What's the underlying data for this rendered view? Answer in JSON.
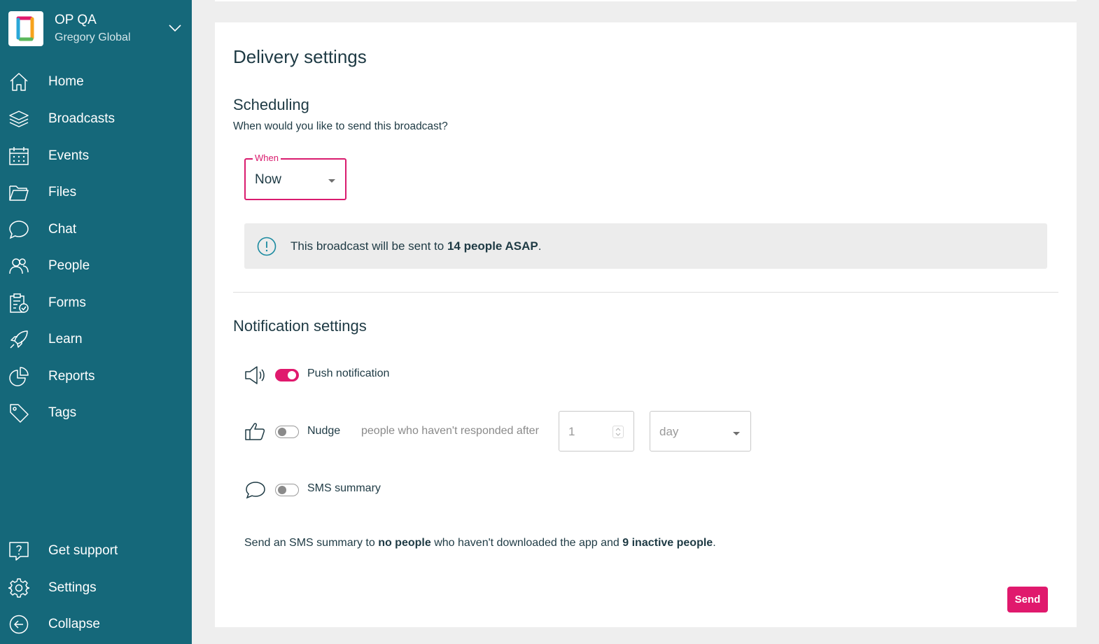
{
  "org": {
    "name": "OP QA",
    "subtitle": "Gregory Global"
  },
  "nav": {
    "items": [
      {
        "label": "Home",
        "icon": "home-icon"
      },
      {
        "label": "Broadcasts",
        "icon": "layers-icon"
      },
      {
        "label": "Events",
        "icon": "calendar-icon"
      },
      {
        "label": "Files",
        "icon": "folder-icon"
      },
      {
        "label": "Chat",
        "icon": "chat-icon"
      },
      {
        "label": "People",
        "icon": "people-icon"
      },
      {
        "label": "Forms",
        "icon": "clipboard-icon"
      },
      {
        "label": "Learn",
        "icon": "rocket-icon"
      },
      {
        "label": "Reports",
        "icon": "pie-chart-icon"
      },
      {
        "label": "Tags",
        "icon": "tag-icon"
      }
    ],
    "bottom": [
      {
        "label": "Get support",
        "icon": "help-icon"
      },
      {
        "label": "Settings",
        "icon": "gear-icon"
      },
      {
        "label": "Collapse",
        "icon": "arrow-left-circle-icon"
      }
    ]
  },
  "page": {
    "title": "Delivery settings"
  },
  "scheduling": {
    "heading": "Scheduling",
    "description": "When would you like to send this broadcast?",
    "when_label": "When",
    "when_value": "Now",
    "info_prefix": "This broadcast will be sent to ",
    "info_bold": "14 people ASAP",
    "info_suffix": "."
  },
  "notifications": {
    "heading": "Notification settings",
    "push": {
      "label": "Push notification",
      "enabled": true
    },
    "nudge": {
      "label": "Nudge",
      "enabled": false,
      "description": "people who haven't responded after",
      "amount": "1",
      "unit": "day"
    },
    "sms": {
      "label": "SMS summary",
      "enabled": false
    },
    "sms_note": {
      "p1": "Send an SMS summary to ",
      "b1": "no people",
      "p2": " who haven't downloaded the app and ",
      "b2": "9 inactive people",
      "p3": "."
    }
  },
  "actions": {
    "send_label": "Send"
  },
  "colors": {
    "sidebar": "#15687a",
    "accent": "#e0196d",
    "text": "#1e3a44"
  }
}
